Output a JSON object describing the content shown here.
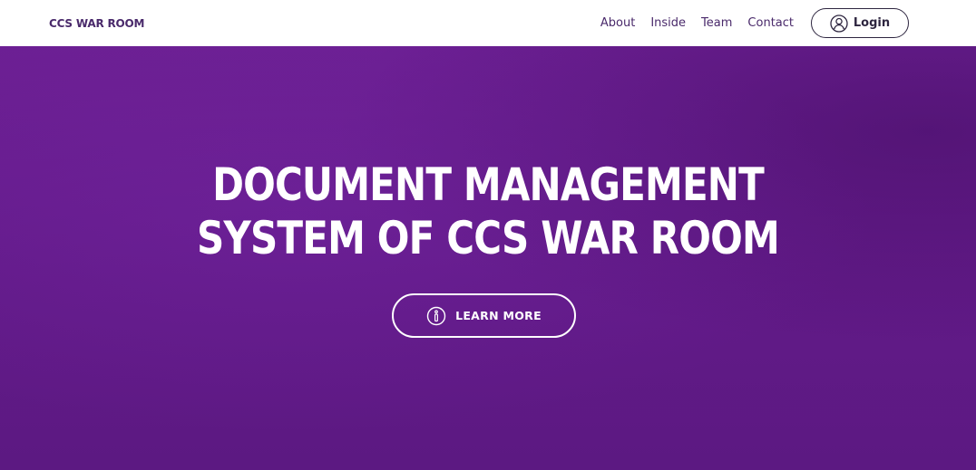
{
  "navbar": {
    "brand": "CCS WAR ROOM",
    "links": [
      {
        "label": "About"
      },
      {
        "label": "Inside"
      },
      {
        "label": "Team"
      },
      {
        "label": "Contact"
      }
    ],
    "login": {
      "label": "Login",
      "icon": "user-icon"
    }
  },
  "hero": {
    "title_line_1": "DOCUMENT MANAGEMENT",
    "title_line_2": "SYSTEM OF CCS WAR ROOM",
    "cta": {
      "label": "LEARN MORE",
      "icon": "info-icon"
    }
  },
  "colors": {
    "brand_text": "#4a2a6b",
    "hero_background": "#651c8d",
    "hero_text": "#ffffff"
  }
}
